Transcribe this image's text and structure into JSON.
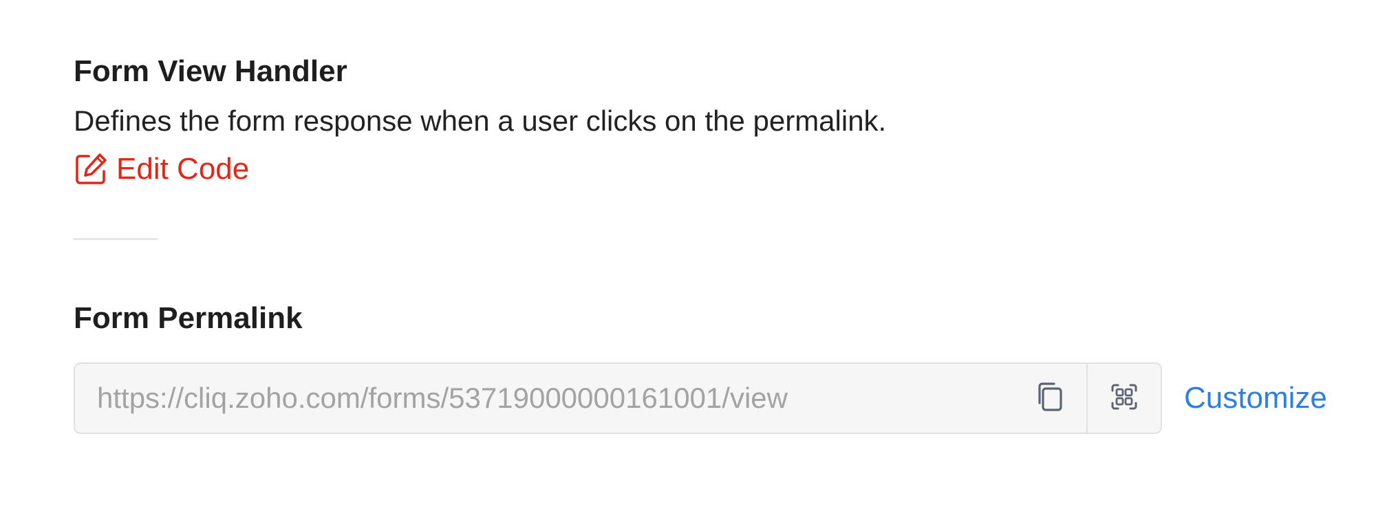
{
  "form_view_handler": {
    "title": "Form View Handler",
    "description": "Defines the form response when a user clicks on the permalink.",
    "edit_label": "Edit Code",
    "edit_icon": "edit-icon"
  },
  "form_permalink": {
    "title": "Form Permalink",
    "url": "https://cliq.zoho.com/forms/53719000000161001/view",
    "copy_icon": "copy-icon",
    "qr_icon": "qr-code-icon",
    "customize_label": "Customize"
  },
  "colors": {
    "accent_red": "#e0271a",
    "link_blue": "#2f7fe0",
    "field_bg": "#f6f6f6",
    "field_text": "#a3a3a3",
    "border": "#e1e1e1"
  }
}
